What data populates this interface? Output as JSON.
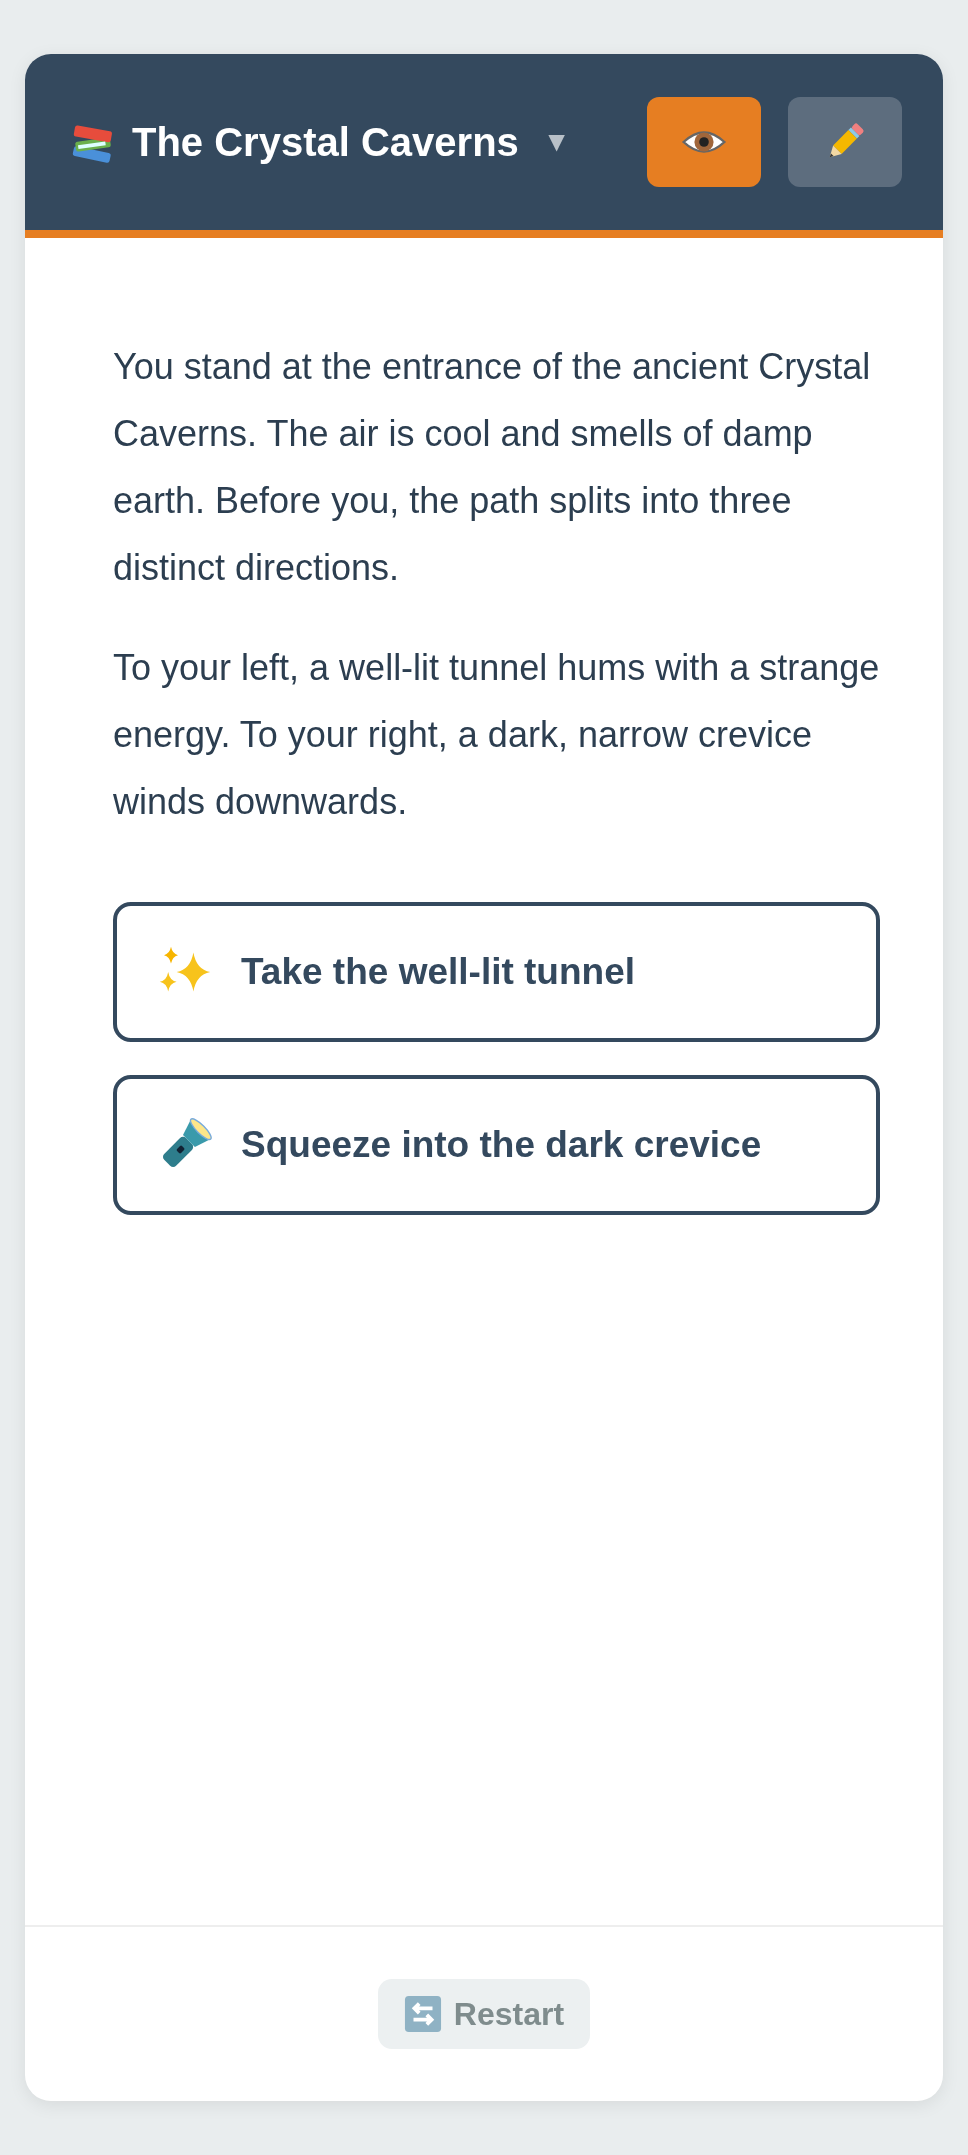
{
  "story": {
    "title": "The Crystal Caverns",
    "dropdown_caret": "▼",
    "modes": [
      {
        "kind": "view",
        "selected": true
      },
      {
        "kind": "edit",
        "selected": false
      }
    ]
  },
  "passage": {
    "paragraphs": [
      "You stand at the entrance of the ancient Crystal Caverns. The air is cool and smells of damp earth. Before you, the path splits into three distinct directions.",
      "To your left, a well-lit tunnel hums with a strange energy. To your right, a dark, narrow crevice winds downwards."
    ]
  },
  "choices": [
    {
      "kind": "sparkles",
      "label": "Take the well-lit tunnel"
    },
    {
      "kind": "flashlight",
      "label": "Squeeze into the dark crevice"
    }
  ],
  "footer": {
    "restart": {
      "label": "Restart",
      "disabled": true
    }
  }
}
